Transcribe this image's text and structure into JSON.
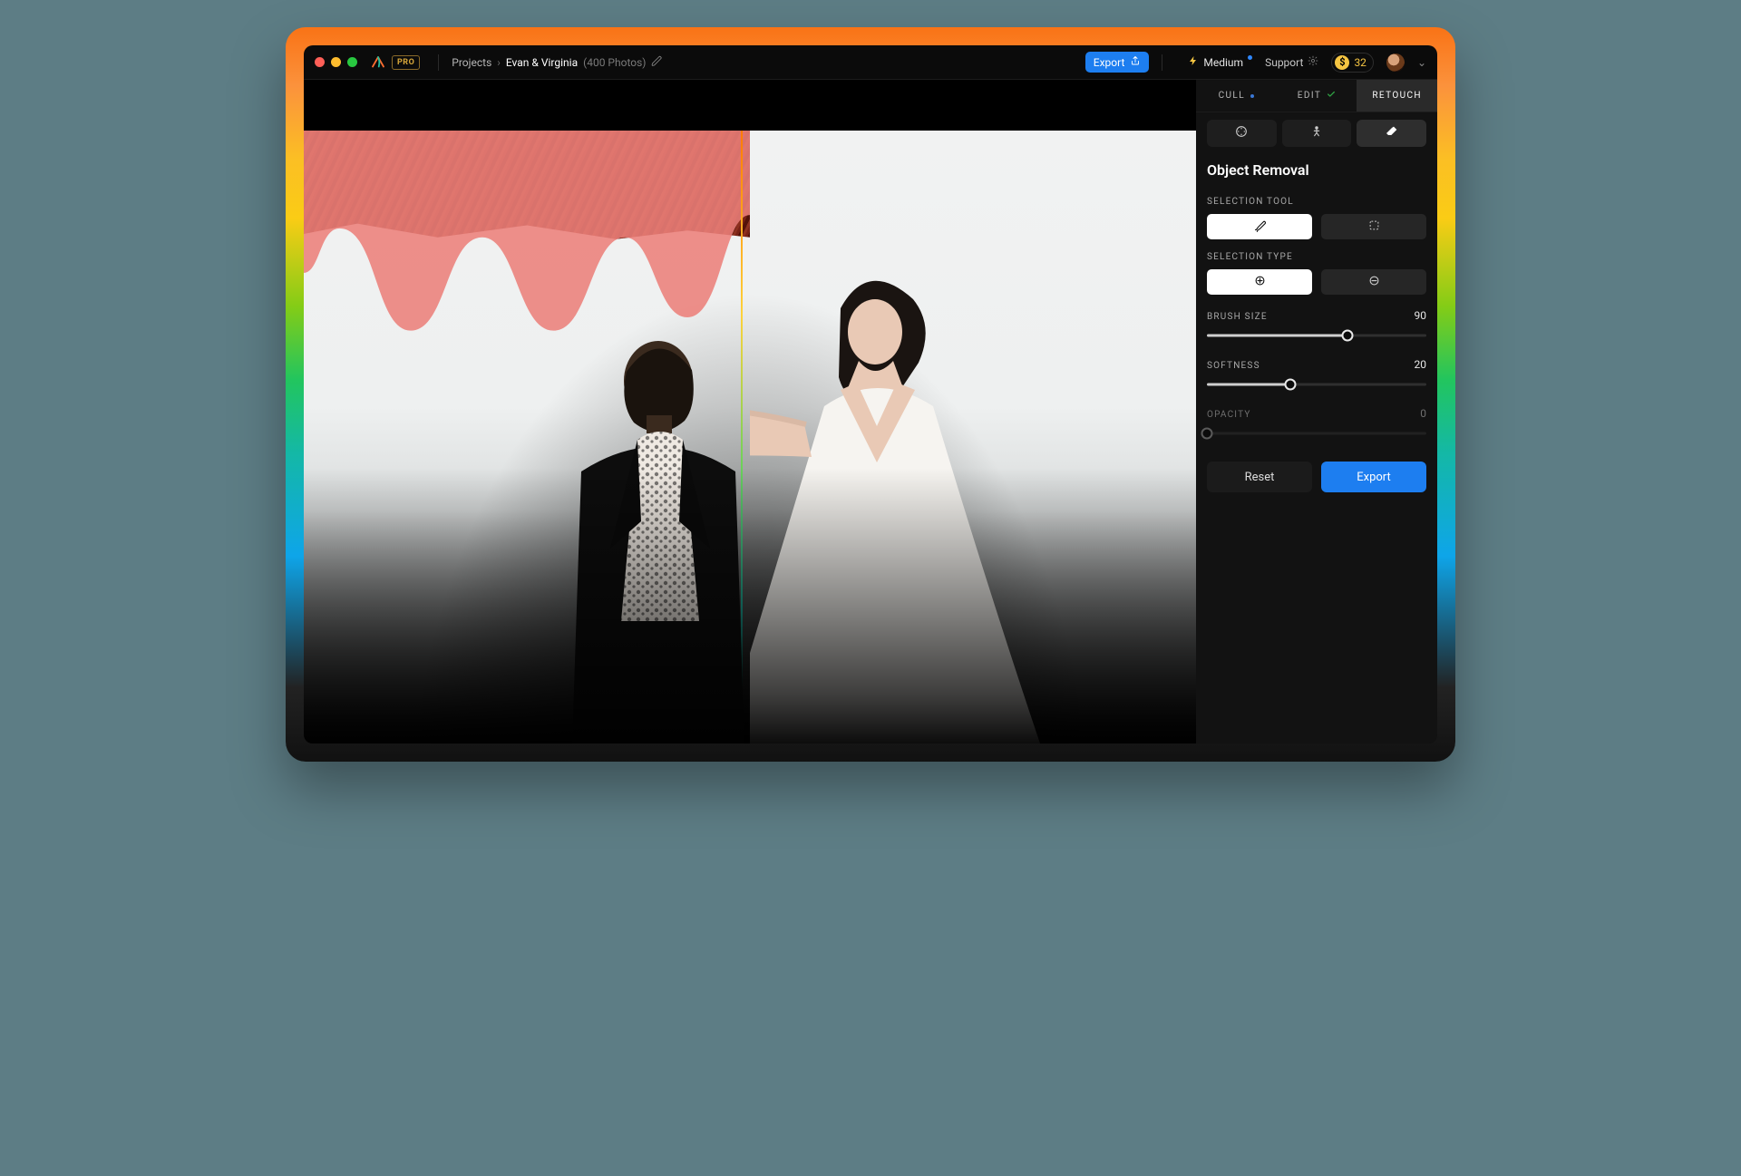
{
  "titlebar": {
    "pro_badge": "PRO",
    "breadcrumb_root": "Projects",
    "breadcrumb_current": "Evan & Virginia",
    "breadcrumb_meta": "(400 Photos)",
    "export_label": "Export",
    "speed_label": "Medium",
    "support_label": "Support",
    "credits": "32"
  },
  "tabs": {
    "cull": "CULL",
    "edit": "EDIT",
    "retouch": "RETOUCH"
  },
  "panel": {
    "title": "Object Removal",
    "selection_tool_label": "SELECTION TOOL",
    "selection_type_label": "SELECTION TYPE",
    "brush_size_label": "BRUSH SIZE",
    "brush_size_value": "90",
    "softness_label": "SOFTNESS",
    "softness_value": "20",
    "opacity_label": "OPACITY",
    "opacity_value": "0",
    "reset_label": "Reset",
    "export_label": "Export"
  },
  "sliders": {
    "brush_size_pct": 64,
    "softness_pct": 38,
    "opacity_pct": 0
  }
}
